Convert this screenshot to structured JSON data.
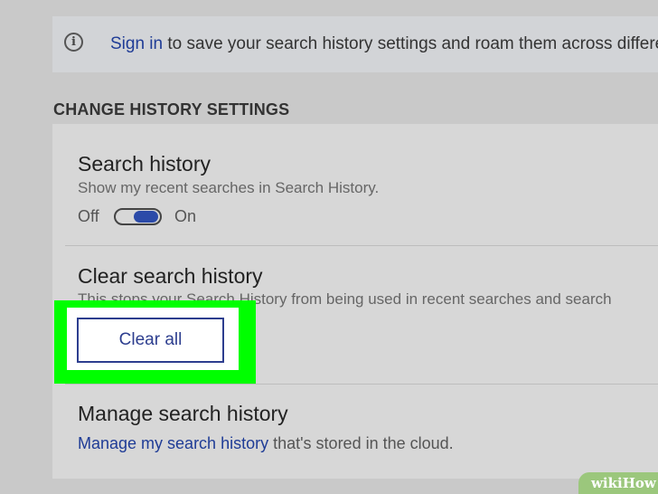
{
  "banner": {
    "link": "Sign in",
    "text": " to save your search history settings and roam them across differe"
  },
  "section_heading": "CHANGE HISTORY SETTINGS",
  "search_history": {
    "title": "Search history",
    "description": "Show my recent searches in Search History.",
    "off_label": "Off",
    "on_label": "On",
    "state": "on"
  },
  "clear_history": {
    "title": "Clear search history",
    "description": "This stops your Search History from being used in recent searches and search",
    "button_label": "Clear all"
  },
  "manage_history": {
    "title": "Manage search history",
    "link": "Manage my search history",
    "text": " that's stored in the cloud."
  },
  "watermark": "wikiHow",
  "colors": {
    "highlight": "#00ff00",
    "link": "#1f3c96",
    "toggle_on": "#2b4aa8"
  }
}
